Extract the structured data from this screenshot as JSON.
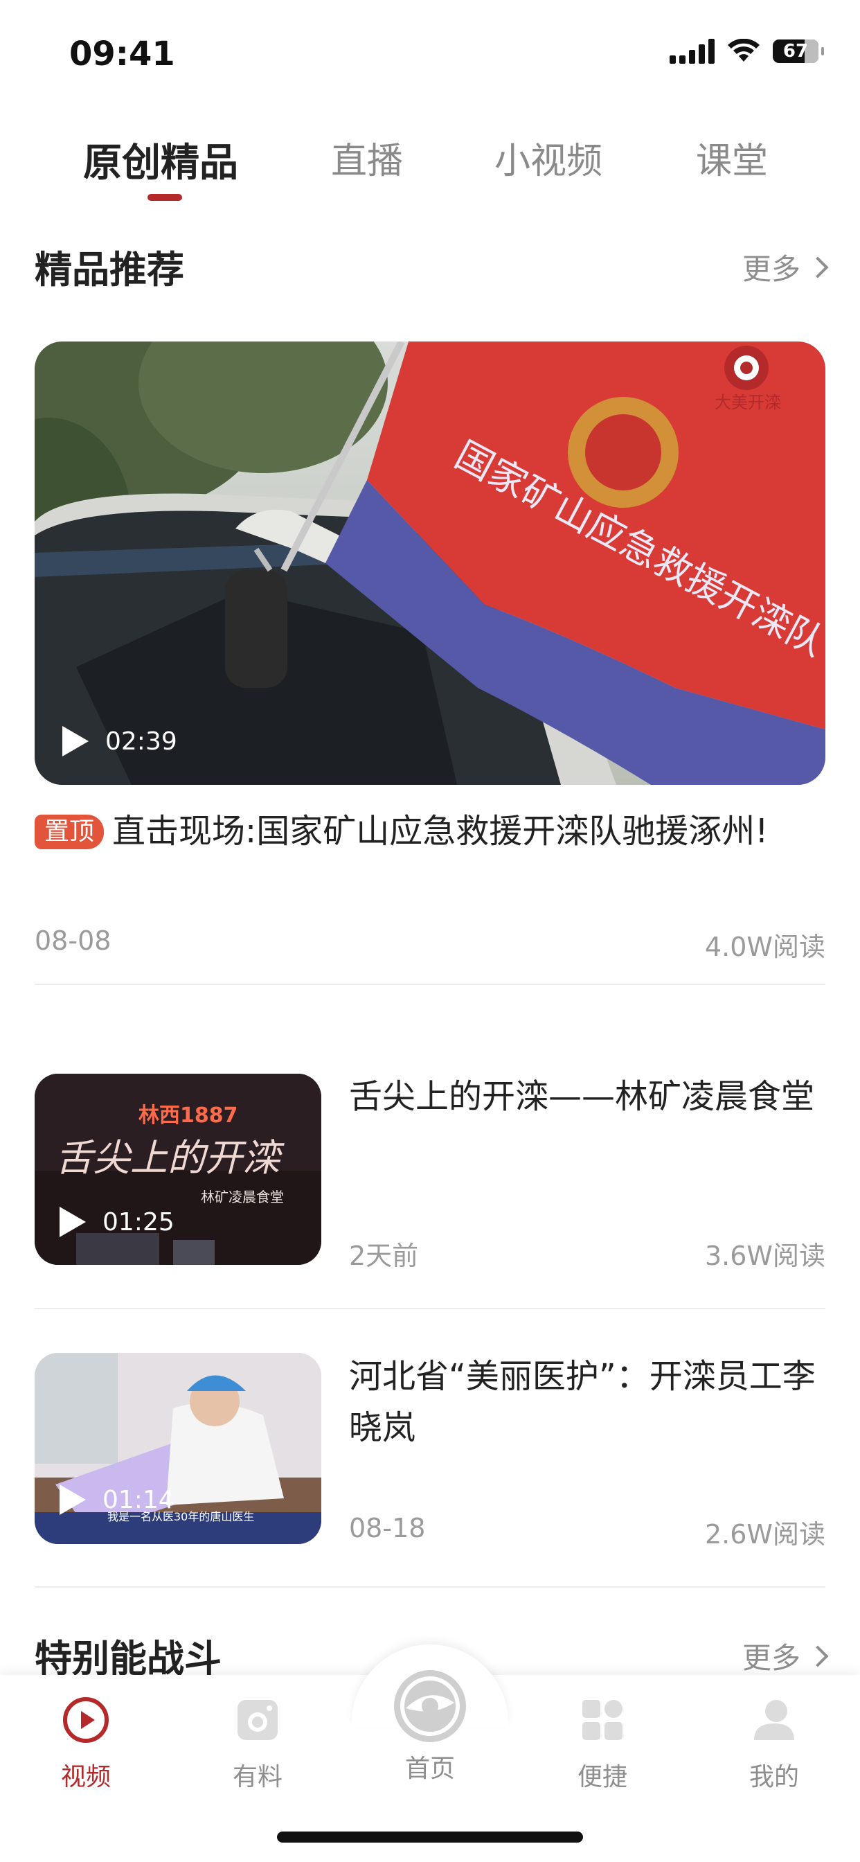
{
  "status_bar": {
    "time": "09:41",
    "battery": "67"
  },
  "tabs": [
    {
      "label": "原创精品",
      "active": true
    },
    {
      "label": "直播",
      "active": false
    },
    {
      "label": "小视频",
      "active": false
    },
    {
      "label": "课堂",
      "active": false
    }
  ],
  "featured_section": {
    "title": "精品推荐",
    "more_label": "更多",
    "featured": {
      "duration": "02:39",
      "badge": "置顶",
      "title": "直击现场:国家矿山应急救援开滦队驰援涿州!",
      "date": "08-08",
      "views": "4.0W阅读",
      "image_text": {
        "flag": "国家矿山应急救援开滦队",
        "logo": "大美开滦"
      }
    },
    "items": [
      {
        "duration": "01:25",
        "title": "舌尖上的开滦——林矿凌晨食堂",
        "date": "2天前",
        "views": "3.6W阅读",
        "image_text": {
          "sign": "林西1887",
          "script": "舌尖上的开滦",
          "sub": "林矿凌晨食堂"
        }
      },
      {
        "duration": "01:14",
        "title": "河北省“美丽医护”：开滦员工李晓岚",
        "date": "08-18",
        "views": "2.6W阅读",
        "image_text": {
          "subtitle": "我是一名从医30年的唐山医生"
        }
      }
    ]
  },
  "second_section": {
    "title": "特别能战斗",
    "more_label": "更多"
  },
  "bottom_nav": [
    {
      "label": "视频",
      "icon": "video-play-icon",
      "active": true
    },
    {
      "label": "有料",
      "icon": "camera-icon",
      "active": false
    },
    {
      "label": "首页",
      "icon": "home-logo-icon",
      "active": false
    },
    {
      "label": "便捷",
      "icon": "grid-apps-icon",
      "active": false
    },
    {
      "label": "我的",
      "icon": "user-icon",
      "active": false
    }
  ],
  "colors": {
    "accent": "#b42a2a",
    "badge": "#e2553b",
    "muted_text": "#9a9a9a"
  }
}
